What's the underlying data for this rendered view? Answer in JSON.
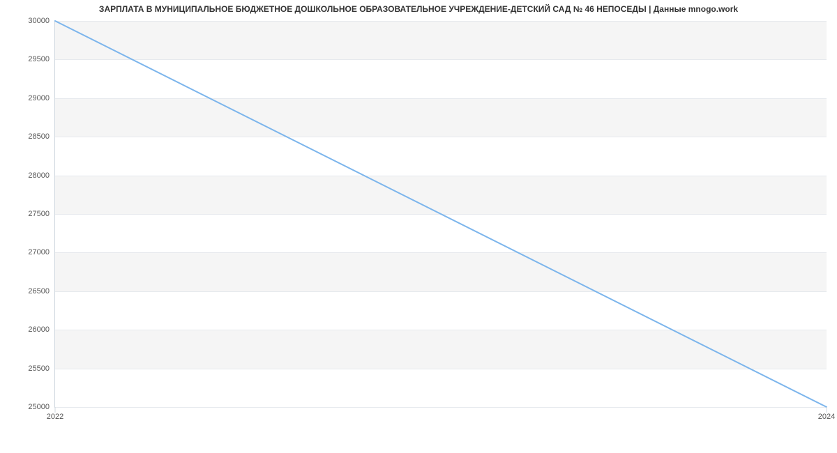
{
  "chart_data": {
    "type": "line",
    "title": "ЗАРПЛАТА В МУНИЦИПАЛЬНОЕ БЮДЖЕТНОЕ ДОШКОЛЬНОЕ ОБРАЗОВАТЕЛЬНОЕ УЧРЕЖДЕНИЕ-ДЕТСКИЙ САД № 46 НЕПОСЕДЫ | Данные mnogo.work",
    "xlabel": "",
    "ylabel": "",
    "x": [
      2022,
      2024
    ],
    "values": [
      30000,
      25000
    ],
    "xlim": [
      2022,
      2024
    ],
    "ylim": [
      25000,
      30000
    ],
    "y_ticks": [
      25000,
      25500,
      26000,
      26500,
      27000,
      27500,
      28000,
      28500,
      29000,
      29500,
      30000
    ],
    "x_ticks": [
      2022,
      2024
    ],
    "grid": true,
    "legend": false,
    "line_color": "#7cb5ec"
  }
}
